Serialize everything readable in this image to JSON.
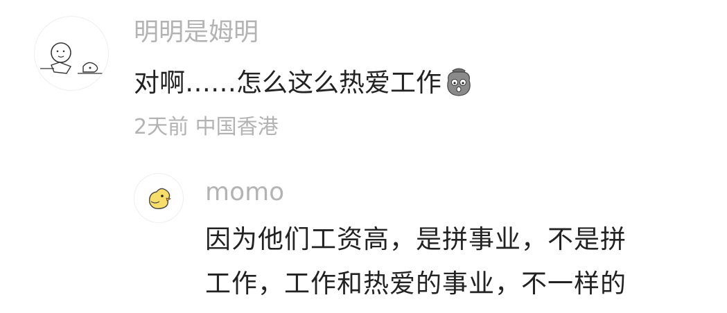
{
  "comment": {
    "username": "明明是姆明",
    "text": "对啊……怎么这么热爱工作",
    "emoji_icon": "sad-sack-emoji",
    "time": "2天前",
    "location": "中国香港",
    "avatar_icon": "cartoon-drawing-avatar"
  },
  "reply": {
    "username": "momo",
    "lines": [
      "因为他们工资高，是拼事业，不是拼",
      "工作，工作和热爱的事业，不一样的"
    ],
    "avatar_icon": "yellow-chick-avatar"
  }
}
